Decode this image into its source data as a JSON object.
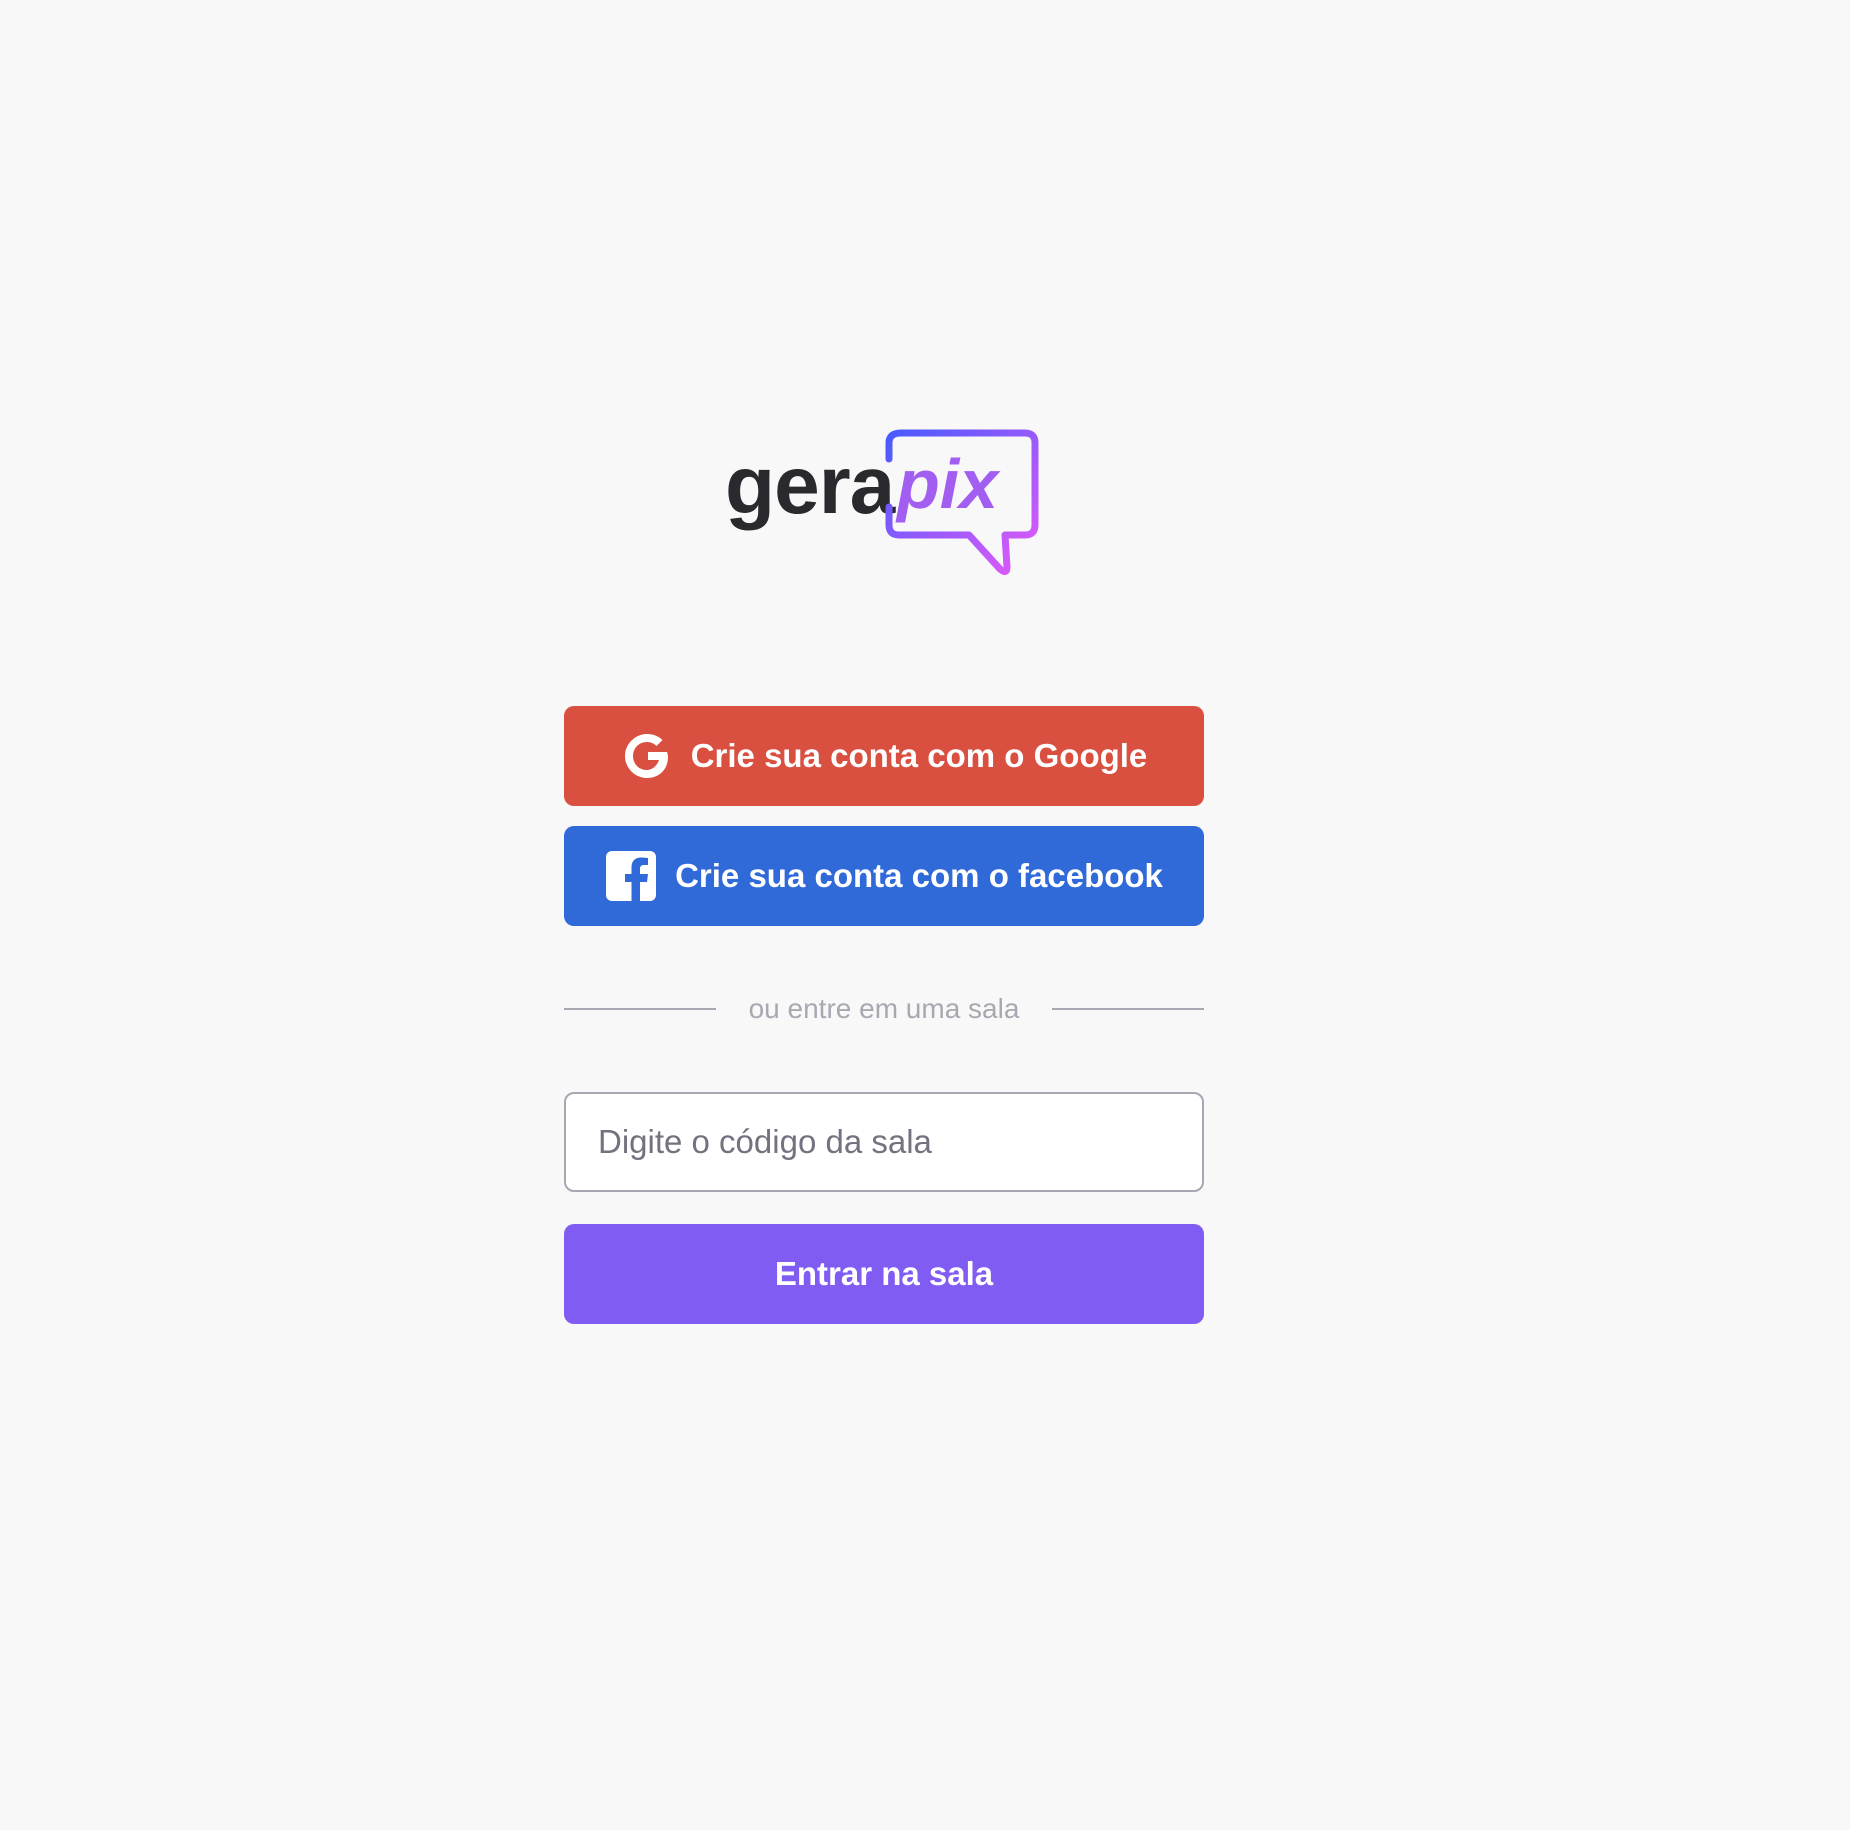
{
  "logo": {
    "word_gera": "gera",
    "word_pix": "pix",
    "gradient_start": "#485bff",
    "gradient_end": "#e559f9"
  },
  "auth": {
    "google_label": "Crie sua conta com o Google",
    "google_icon": "google-icon",
    "google_color": "#d95040",
    "facebook_label": "Crie sua conta com o facebook",
    "facebook_icon": "facebook-icon",
    "facebook_color": "#3069d8"
  },
  "separator": {
    "text": "ou entre em uma sala"
  },
  "room": {
    "placeholder": "Digite o código da sala",
    "value": "",
    "submit_label": "Entrar na sala",
    "submit_color": "#805cf2"
  }
}
